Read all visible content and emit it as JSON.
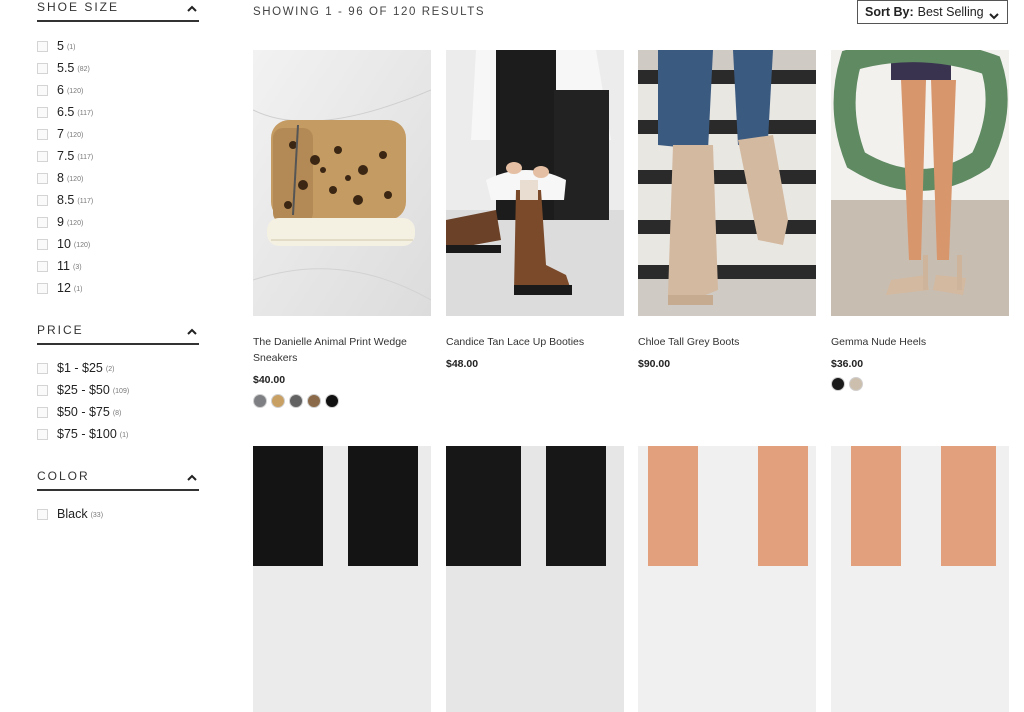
{
  "filters": {
    "shoe_size": {
      "title": "SHOE SIZE",
      "options": [
        {
          "label": "5",
          "count": "(1)"
        },
        {
          "label": "5.5",
          "count": "(82)"
        },
        {
          "label": "6",
          "count": "(120)"
        },
        {
          "label": "6.5",
          "count": "(117)"
        },
        {
          "label": "7",
          "count": "(120)"
        },
        {
          "label": "7.5",
          "count": "(117)"
        },
        {
          "label": "8",
          "count": "(120)"
        },
        {
          "label": "8.5",
          "count": "(117)"
        },
        {
          "label": "9",
          "count": "(120)"
        },
        {
          "label": "10",
          "count": "(120)"
        },
        {
          "label": "11",
          "count": "(3)"
        },
        {
          "label": "12",
          "count": "(1)"
        }
      ]
    },
    "price": {
      "title": "PRICE",
      "options": [
        {
          "label": "$1 - $25",
          "count": "(2)"
        },
        {
          "label": "$25 - $50",
          "count": "(109)"
        },
        {
          "label": "$50 - $75",
          "count": "(8)"
        },
        {
          "label": "$75 - $100",
          "count": "(1)"
        }
      ]
    },
    "color": {
      "title": "COLOR",
      "options": [
        {
          "label": "Black",
          "count": "(33)"
        }
      ]
    }
  },
  "results_text": "SHOWING 1 - 96 OF 120 RESULTS",
  "sort": {
    "label": "Sort By:",
    "value": "Best Selling"
  },
  "products": [
    {
      "name": "The Danielle Animal Print Wedge Sneakers",
      "price": "$40.00",
      "swatches": [
        "#7d7f83",
        "#c8a064",
        "#626262",
        "#8a6a48",
        "#111111"
      ]
    },
    {
      "name": "Candice Tan Lace Up Booties",
      "price": "$48.00",
      "swatches": []
    },
    {
      "name": "Chloe Tall Grey Boots",
      "price": "$90.00",
      "swatches": []
    },
    {
      "name": "Gemma Nude Heels",
      "price": "$36.00",
      "swatches": [
        "#1a1a1a",
        "#cdbfae"
      ]
    }
  ],
  "icons": {
    "collapse": "chevron-up-icon",
    "sort": "chevron-down-icon"
  },
  "colors": {
    "accent": "#333333",
    "swatch_border": "#cfcfcf"
  }
}
